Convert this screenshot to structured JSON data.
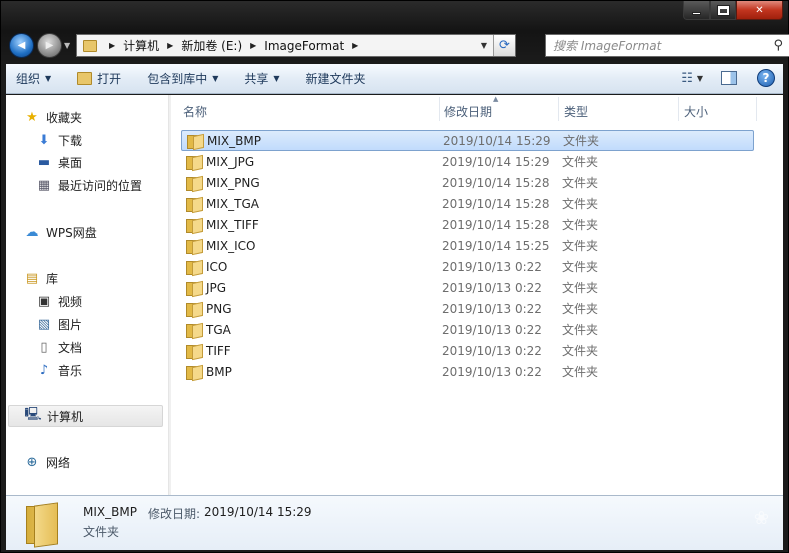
{
  "window": {
    "caption": {
      "minimize": "",
      "maximize": "",
      "close": "✕"
    }
  },
  "nav": {
    "back_icon": "◀",
    "forward_icon": "▶",
    "address": {
      "crumbs": [
        "计算机",
        "新加卷 (E:)",
        "ImageFormat"
      ]
    },
    "search": {
      "placeholder": "搜索 ImageFormat"
    }
  },
  "toolbar": {
    "organize": "组织",
    "open": "打开",
    "include_in_library": "包含到库中",
    "share": "共享",
    "new_folder": "新建文件夹"
  },
  "sidebar": {
    "favorites": {
      "label": "收藏夹",
      "items": [
        {
          "label": "下载"
        },
        {
          "label": "桌面"
        },
        {
          "label": "最近访问的位置"
        }
      ]
    },
    "wps": {
      "label": "WPS网盘"
    },
    "libraries": {
      "label": "库",
      "items": [
        {
          "label": "视频"
        },
        {
          "label": "图片"
        },
        {
          "label": "文档"
        },
        {
          "label": "音乐"
        }
      ]
    },
    "computer": {
      "label": "计算机"
    },
    "network": {
      "label": "网络"
    }
  },
  "columns": {
    "name": "名称",
    "date": "修改日期",
    "type": "类型",
    "size": "大小"
  },
  "files": [
    {
      "name": "MIX_BMP",
      "date": "2019/10/14 15:29",
      "type": "文件夹"
    },
    {
      "name": "MIX_JPG",
      "date": "2019/10/14 15:29",
      "type": "文件夹"
    },
    {
      "name": "MIX_PNG",
      "date": "2019/10/14 15:28",
      "type": "文件夹"
    },
    {
      "name": "MIX_TGA",
      "date": "2019/10/14 15:28",
      "type": "文件夹"
    },
    {
      "name": "MIX_TIFF",
      "date": "2019/10/14 15:28",
      "type": "文件夹"
    },
    {
      "name": "MIX_ICO",
      "date": "2019/10/14 15:25",
      "type": "文件夹"
    },
    {
      "name": "ICO",
      "date": "2019/10/13 0:22",
      "type": "文件夹"
    },
    {
      "name": "JPG",
      "date": "2019/10/13 0:22",
      "type": "文件夹"
    },
    {
      "name": "PNG",
      "date": "2019/10/13 0:22",
      "type": "文件夹"
    },
    {
      "name": "TGA",
      "date": "2019/10/13 0:22",
      "type": "文件夹"
    },
    {
      "name": "TIFF",
      "date": "2019/10/13 0:22",
      "type": "文件夹"
    },
    {
      "name": "BMP",
      "date": "2019/10/13 0:22",
      "type": "文件夹"
    }
  ],
  "details": {
    "name": "MIX_BMP",
    "date_label": "修改日期:",
    "date_value": "2019/10/14 15:29",
    "type": "文件夹"
  }
}
